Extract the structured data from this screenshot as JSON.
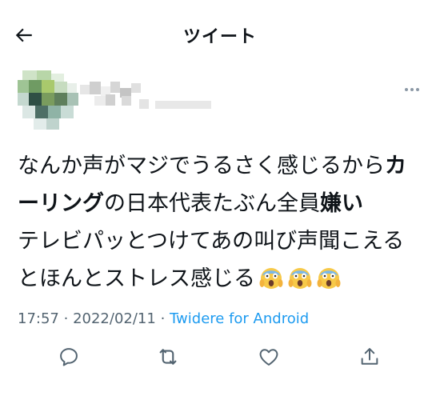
{
  "header": {
    "title": "ツイート",
    "back_icon": "arrow-left-icon"
  },
  "tweet": {
    "lines": [
      {
        "parts": [
          {
            "text": "なんか声がマジでうるさく感じるから",
            "bold": false
          },
          {
            "text": "カ",
            "bold": true
          }
        ]
      },
      {
        "parts": [
          {
            "text": "ーリング",
            "bold": true
          },
          {
            "text": "の日本代表たぶん全員",
            "bold": false
          },
          {
            "text": "嫌い",
            "bold": true
          }
        ]
      },
      {
        "parts": [
          {
            "text": "テレビパッとつけてあの叫び声聞こえる",
            "bold": false
          }
        ]
      },
      {
        "parts": [
          {
            "text": "とほんとストレス感じる",
            "bold": false
          }
        ]
      }
    ],
    "emojis": [
      "screaming-face-icon",
      "screaming-face-icon",
      "screaming-face-icon"
    ],
    "time": "17:57",
    "separator": "·",
    "date": "2022/02/11",
    "source": "Twidere for Android"
  },
  "actions": [
    {
      "name": "reply-button",
      "icon": "comment-icon"
    },
    {
      "name": "retweet-button",
      "icon": "retweet-icon"
    },
    {
      "name": "like-button",
      "icon": "heart-icon"
    },
    {
      "name": "share-button",
      "icon": "share-icon"
    }
  ],
  "colors": {
    "text": "#0f1419",
    "meta": "#536471",
    "link": "#1d9bf0",
    "icon": "#536471"
  }
}
